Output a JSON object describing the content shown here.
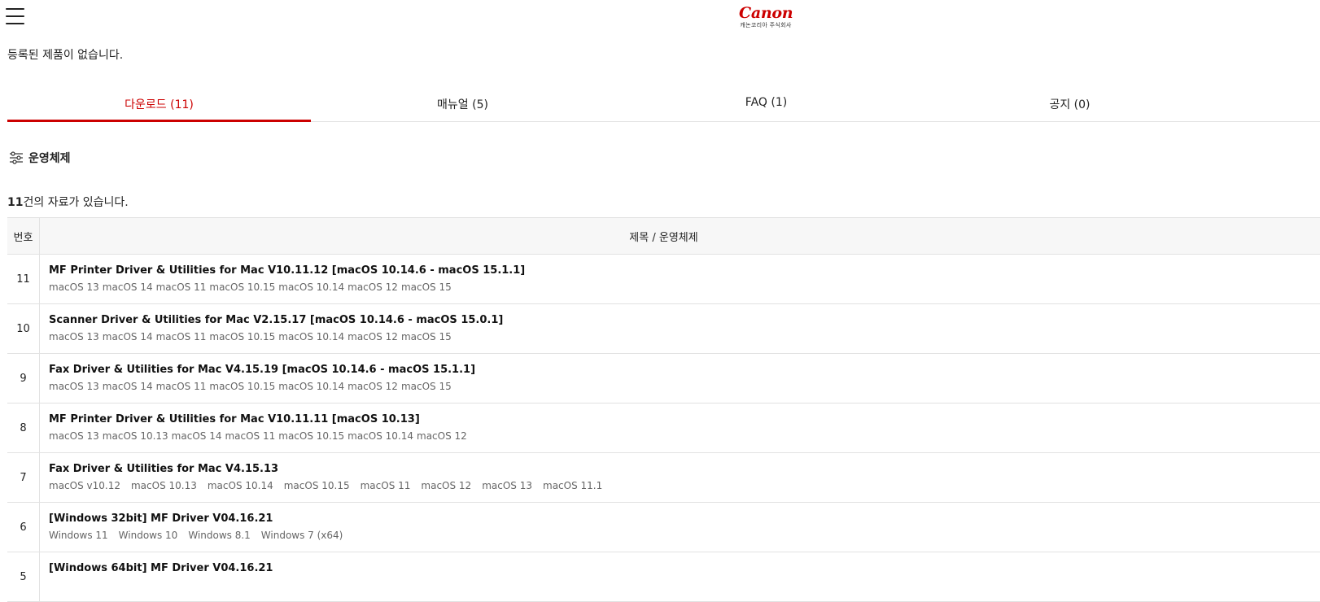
{
  "header": {
    "logo_text": "Canon",
    "logo_sub": "캐논코리아 주식회사",
    "brand_color": "#cc0000"
  },
  "registered_message": "등록된 제품이 없습니다.",
  "tabs": [
    {
      "label": "다운로드  (11)",
      "active": true
    },
    {
      "label": "매뉴얼  (5)",
      "active": false
    },
    {
      "label": "FAQ  (1)",
      "active": false
    },
    {
      "label": "공지  (0)",
      "active": false
    }
  ],
  "filter": {
    "label": "운영체제",
    "icon": "sliders-icon"
  },
  "result": {
    "count": "11",
    "suffix": "건의 자료가 있습니다."
  },
  "table": {
    "headers": {
      "no": "번호",
      "title": "제목 / 운영체제"
    },
    "rows": [
      {
        "no": "11",
        "title": "MF Printer Driver & Utilities for Mac V10.11.12 [macOS 10.14.6 - macOS 15.1.1]",
        "spacing": "tight",
        "os": [
          "macOS 13",
          "macOS 14",
          "macOS 11",
          "macOS 10.15",
          "macOS 10.14",
          "macOS 12",
          "macOS 15"
        ]
      },
      {
        "no": "10",
        "title": "Scanner Driver & Utilities for Mac V2.15.17 [macOS 10.14.6 - macOS 15.0.1]",
        "spacing": "tight",
        "os": [
          "macOS 13",
          "macOS 14",
          "macOS 11",
          "macOS 10.15",
          "macOS 10.14",
          "macOS 12",
          "macOS 15"
        ]
      },
      {
        "no": "9",
        "title": "Fax Driver & Utilities for Mac V4.15.19 [macOS 10.14.6 - macOS 15.1.1]",
        "spacing": "tight",
        "os": [
          "macOS 13",
          "macOS 14",
          "macOS 11",
          "macOS 10.15",
          "macOS 10.14",
          "macOS 12",
          "macOS 15"
        ]
      },
      {
        "no": "8",
        "title": "MF Printer Driver & Utilities for Mac V10.11.11 [macOS 10.13]",
        "spacing": "tight",
        "os": [
          "macOS 13",
          "macOS 10.13",
          "macOS 14",
          "macOS 11",
          "macOS 10.15",
          "macOS 10.14",
          "macOS 12"
        ]
      },
      {
        "no": "7",
        "title": "Fax Driver & Utilities for Mac V4.15.13",
        "spacing": "spaced",
        "os": [
          "macOS v10.12",
          "macOS 10.13",
          "macOS 10.14",
          "macOS 10.15",
          "macOS 11",
          "macOS 12",
          "macOS 13",
          "macOS 11.1"
        ]
      },
      {
        "no": "6",
        "title": "[Windows 32bit] MF Driver V04.16.21",
        "spacing": "spaced",
        "os": [
          "Windows 11",
          "Windows 10",
          "Windows 8.1",
          "Windows 7 (x64)"
        ]
      },
      {
        "no": "5",
        "title": "[Windows 64bit] MF Driver V04.16.21",
        "spacing": "spaced",
        "os": []
      }
    ]
  }
}
